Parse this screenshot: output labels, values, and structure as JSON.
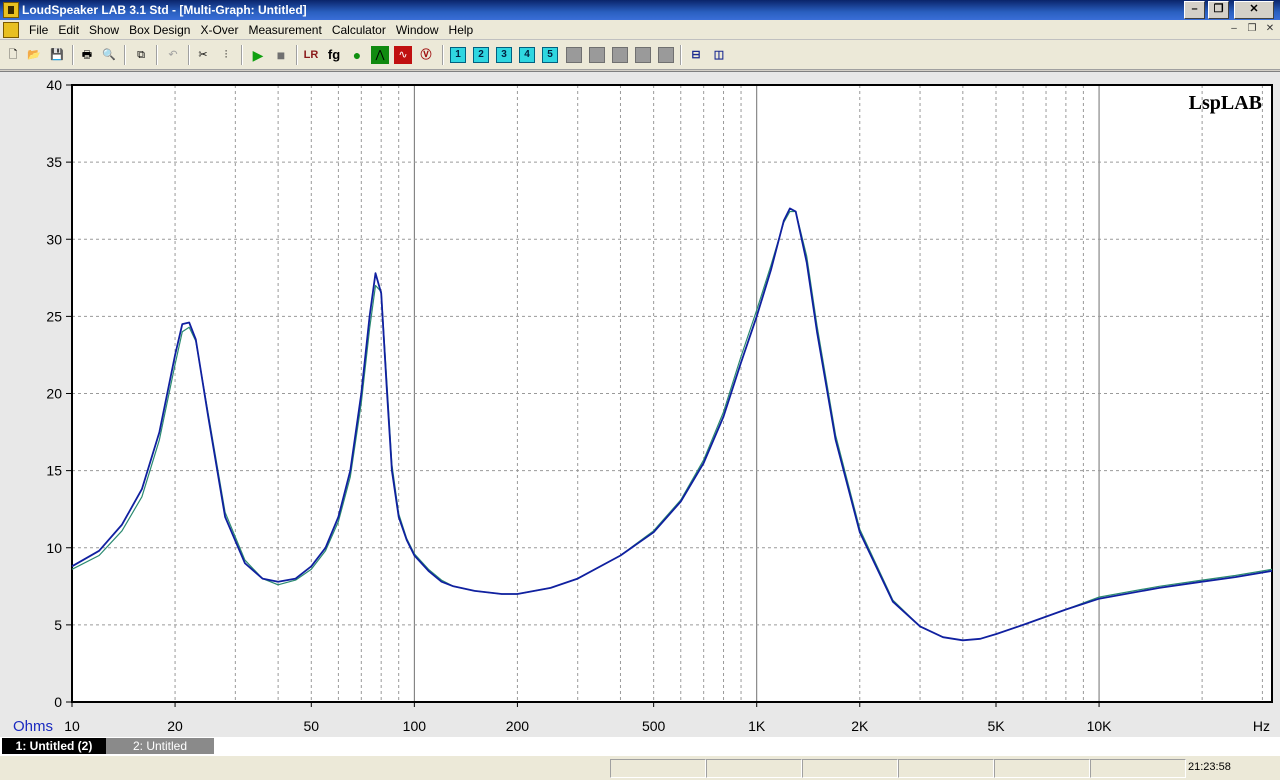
{
  "window": {
    "title": "LoudSpeaker LAB 3.1 Std - [Multi-Graph: Untitled]",
    "controls": [
      "minimize",
      "maximize",
      "close"
    ]
  },
  "menu": [
    "File",
    "Edit",
    "Show",
    "Box Design",
    "X-Over",
    "Measurement",
    "Calculator",
    "Window",
    "Help"
  ],
  "toolbar": {
    "icons": [
      "new-icon",
      "open-icon",
      "save-icon",
      "print-icon",
      "print-preview-icon",
      "copy-icon",
      "undo-icon",
      "tools-icon",
      "sliders-icon",
      "play-icon",
      "stop-icon",
      "lr-icon",
      "fg-icon",
      "green-circle-icon",
      "peak-icon",
      "red-wave-icon",
      "v-icon"
    ],
    "lr_label": "LR",
    "fg_label": "fg",
    "graph_buttons": [
      "1",
      "2",
      "3",
      "4",
      "5"
    ]
  },
  "chart_data": {
    "type": "line",
    "title": "",
    "watermark": "LspLAB",
    "ylabel": "Ohms",
    "xlabel": "Hz",
    "x_scale": "log",
    "xlim": [
      10,
      32000
    ],
    "ylim": [
      0,
      40
    ],
    "y_ticks": [
      0,
      5,
      10,
      15,
      20,
      25,
      30,
      35,
      40
    ],
    "x_tick_labels": [
      {
        "value": 10,
        "label": "10"
      },
      {
        "value": 20,
        "label": "20"
      },
      {
        "value": 50,
        "label": "50"
      },
      {
        "value": 100,
        "label": "100"
      },
      {
        "value": 200,
        "label": "200"
      },
      {
        "value": 500,
        "label": "500"
      },
      {
        "value": 1000,
        "label": "1K"
      },
      {
        "value": 2000,
        "label": "2K"
      },
      {
        "value": 5000,
        "label": "5K"
      },
      {
        "value": 10000,
        "label": "10K"
      }
    ],
    "grid": true,
    "series": [
      {
        "color": "#1020a0",
        "x": [
          10,
          12,
          14,
          16,
          18,
          20,
          21,
          22,
          23,
          25,
          28,
          32,
          36,
          40,
          45,
          50,
          55,
          60,
          65,
          70,
          74,
          77,
          80,
          83,
          86,
          90,
          95,
          100,
          110,
          120,
          130,
          150,
          180,
          200,
          250,
          300,
          400,
          500,
          600,
          700,
          800,
          900,
          1000,
          1100,
          1200,
          1250,
          1300,
          1400,
          1500,
          1700,
          2000,
          2500,
          3000,
          3500,
          4000,
          4500,
          5000,
          6000,
          8000,
          10000,
          15000,
          20000,
          25000,
          32000
        ],
        "values": [
          8.8,
          9.8,
          11.5,
          13.8,
          17.5,
          22.5,
          24.5,
          24.6,
          23.5,
          18.5,
          12.0,
          9.0,
          8.0,
          7.8,
          8.0,
          8.8,
          10.0,
          12.0,
          15.0,
          20.0,
          25.0,
          27.8,
          26.5,
          20.5,
          15.0,
          12.0,
          10.5,
          9.5,
          8.5,
          7.8,
          7.5,
          7.2,
          7.0,
          7.0,
          7.4,
          8.0,
          9.5,
          11.0,
          13.0,
          15.5,
          18.5,
          22.0,
          25.0,
          28.0,
          31.2,
          32.0,
          31.8,
          28.5,
          24.0,
          17.0,
          11.0,
          6.5,
          4.9,
          4.2,
          4.0,
          4.1,
          4.4,
          5.0,
          6.0,
          6.7,
          7.4,
          7.8,
          8.1,
          8.5
        ]
      },
      {
        "color": "#2a8a70",
        "x": [
          10,
          12,
          14,
          16,
          18,
          20,
          21,
          22,
          23,
          25,
          28,
          32,
          36,
          40,
          45,
          50,
          55,
          60,
          65,
          70,
          74,
          77,
          80,
          83,
          86,
          90,
          95,
          100,
          110,
          120,
          130,
          150,
          180,
          200,
          250,
          300,
          400,
          500,
          600,
          700,
          800,
          900,
          1000,
          1100,
          1200,
          1250,
          1300,
          1400,
          1500,
          1700,
          2000,
          2500,
          3000,
          3500,
          4000,
          4500,
          5000,
          6000,
          8000,
          10000,
          15000,
          20000,
          25000,
          32000
        ],
        "values": [
          8.6,
          9.5,
          11.1,
          13.3,
          17.0,
          21.9,
          24.0,
          24.3,
          23.4,
          18.7,
          12.3,
          9.2,
          8.0,
          7.6,
          7.9,
          8.6,
          9.8,
          11.7,
          14.6,
          19.4,
          24.2,
          27.0,
          26.6,
          21.0,
          15.4,
          12.2,
          10.6,
          9.6,
          8.6,
          7.9,
          7.5,
          7.2,
          7.0,
          7.0,
          7.4,
          8.0,
          9.5,
          11.1,
          13.1,
          15.7,
          18.8,
          22.4,
          25.4,
          28.3,
          31.1,
          31.8,
          31.8,
          28.9,
          24.4,
          17.3,
          11.2,
          6.6,
          4.9,
          4.2,
          4.0,
          4.1,
          4.4,
          5.0,
          6.0,
          6.8,
          7.5,
          7.9,
          8.2,
          8.6
        ]
      }
    ]
  },
  "tabs": [
    {
      "label": "1: Untitled (2)",
      "active": true
    },
    {
      "label": "2: Untitled",
      "active": false
    }
  ],
  "status": {
    "time": "21:23:58"
  }
}
